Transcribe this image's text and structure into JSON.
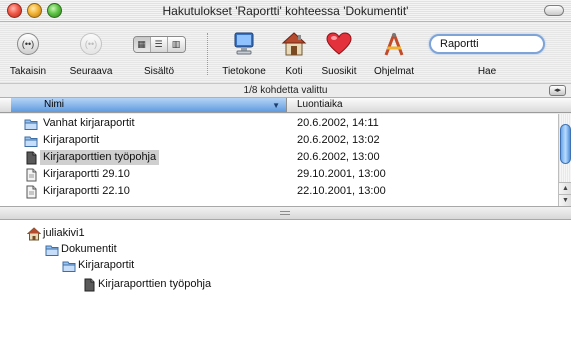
{
  "window": {
    "title": "Hakutulokset 'Raportti' kohteessa 'Dokumentit'"
  },
  "toolbar": {
    "back_label": "Takaisin",
    "forward_label": "Seuraava",
    "view_label": "Sisältö",
    "computer_label": "Tietokone",
    "home_label": "Koti",
    "favorites_label": "Suosikit",
    "applications_label": "Ohjelmat",
    "search_label": "Hae",
    "search_value": "Raportti",
    "back_glyph": "(••)",
    "forward_glyph": "(••)"
  },
  "status": {
    "text": "1/8 kohdetta valittu"
  },
  "columns": {
    "name": "Nimi",
    "date": "Luontiaika"
  },
  "results": [
    {
      "name": "Vanhat kirjaraportit",
      "date": "20.6.2002, 14:11",
      "kind": "folder",
      "selected": false
    },
    {
      "name": "Kirjaraportit",
      "date": "20.6.2002, 13:02",
      "kind": "folder",
      "selected": false
    },
    {
      "name": "Kirjaraporttien työpohja",
      "date": "20.6.2002, 13:00",
      "kind": "template",
      "selected": true
    },
    {
      "name": "Kirjaraportti 29.10",
      "date": "29.10.2001, 13:00",
      "kind": "document",
      "selected": false
    },
    {
      "name": "Kirjaraportti 22.10",
      "date": "22.10.2001, 13:00",
      "kind": "document",
      "selected": false
    }
  ],
  "path": [
    {
      "name": "juliakivi1",
      "kind": "home",
      "level": 0
    },
    {
      "name": "Dokumentit",
      "kind": "folder",
      "level": 1
    },
    {
      "name": "Kirjaraportit",
      "kind": "folder",
      "level": 2
    },
    {
      "name": "Kirjaraporttien työpohja",
      "kind": "template",
      "level": 3
    }
  ],
  "colors": {
    "selection_header": "#5f9bdf",
    "scroll_thumb": "#6aa6ea",
    "search_focus": "#7ea3d6"
  }
}
